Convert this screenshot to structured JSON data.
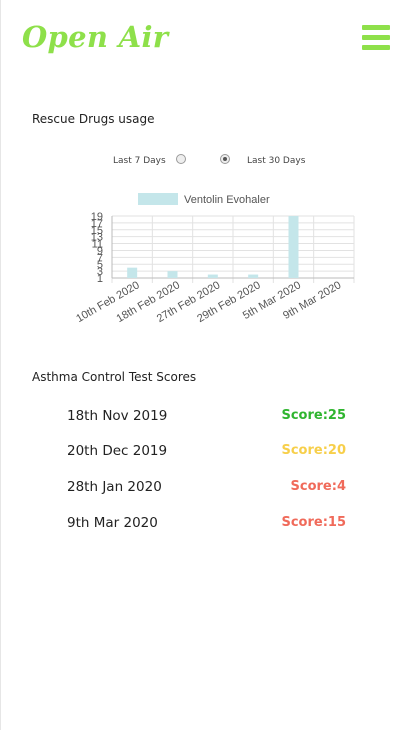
{
  "header": {
    "logo": "Open Air",
    "menu_icon": "hamburger-menu-icon",
    "brand_color": "#8ee04a"
  },
  "rescue": {
    "title": "Rescue Drugs usage",
    "options": [
      {
        "label": "Last 7 Days",
        "selected": false
      },
      {
        "label": "Last 30 Days",
        "selected": true
      }
    ]
  },
  "chart_data": {
    "type": "bar",
    "legend": "Ventolin Evohaler",
    "legend_placement": "top",
    "categories": [
      "10th Feb 2020",
      "18th Feb 2020",
      "27th Feb 2020",
      "29th Feb 2020",
      "5th Mar 2020",
      "9th Mar 2020"
    ],
    "series": [
      {
        "name": "Ventolin Evohaler",
        "values": [
          4,
          3,
          2,
          2,
          19,
          1
        ]
      }
    ],
    "ylim": [
      1,
      19
    ],
    "yticks": [
      1,
      3,
      5,
      7,
      9,
      11,
      13,
      15,
      17,
      19
    ],
    "grid": true,
    "bar_color": "#c4e6ea"
  },
  "act": {
    "title": "Asthma Control Test Scores",
    "scores": [
      {
        "date": "18th Nov 2019",
        "score": "Score:25",
        "color": "#2fb52f"
      },
      {
        "date": "20th Dec 2019",
        "score": "Score:20",
        "color": "#f7cf4a"
      },
      {
        "date": "28th Jan 2020",
        "score": "Score:4",
        "color": "#f06a5a"
      },
      {
        "date": "9th Mar 2020",
        "score": "Score:15",
        "color": "#f06a5a"
      }
    ]
  }
}
